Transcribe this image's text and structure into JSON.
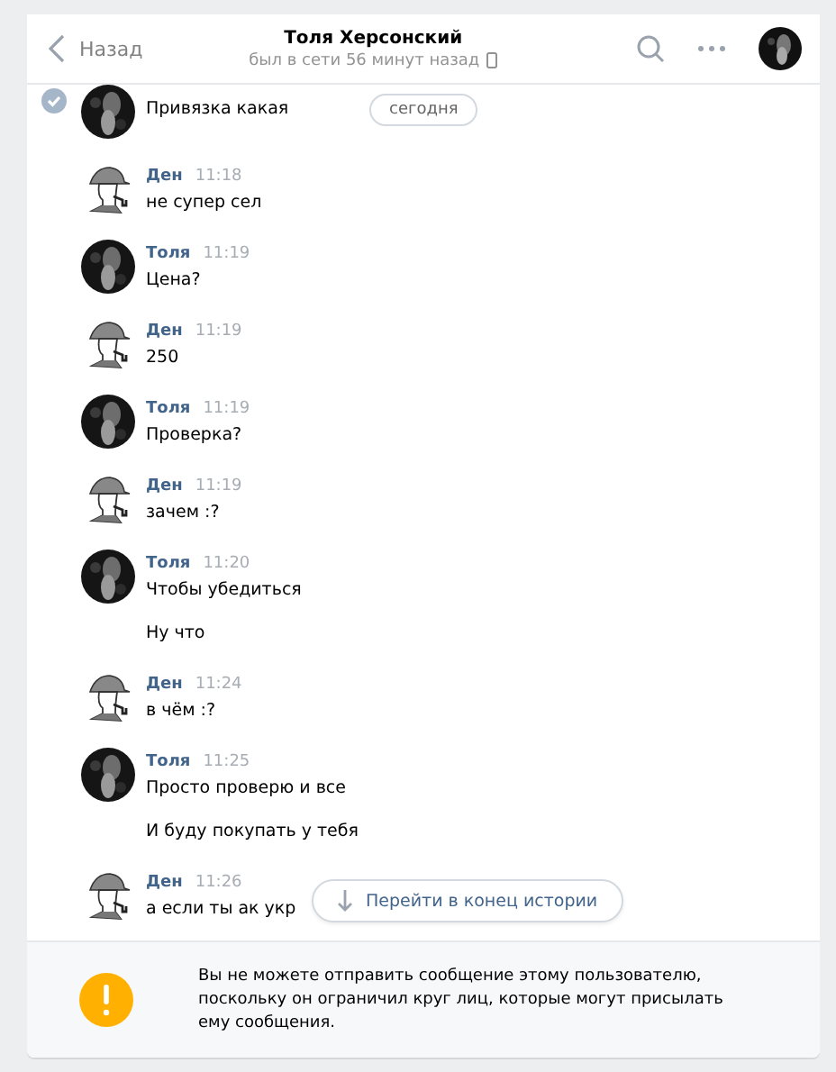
{
  "header": {
    "back": "Назад",
    "title": "Толя Херсонский",
    "status": "был в сети 56 минут назад"
  },
  "date_pill": "сегодня",
  "messages": [
    {
      "selected": true,
      "texts": [
        "Привязка какая"
      ]
    },
    {
      "kind": "detective",
      "selected": false,
      "author": "Ден",
      "time": "11:18",
      "texts": [
        "не супер сел"
      ]
    },
    {
      "selected": false,
      "author": "Толя",
      "time": "11:19",
      "texts": [
        "Цена?"
      ]
    },
    {
      "kind": "detective",
      "selected": false,
      "author": "Ден",
      "time": "11:19",
      "texts": [
        "250"
      ]
    },
    {
      "selected": false,
      "author": "Толя",
      "time": "11:19",
      "texts": [
        "Проверка?"
      ]
    },
    {
      "kind": "detective",
      "selected": false,
      "author": "Ден",
      "time": "11:19",
      "texts": [
        "зачем :?"
      ]
    },
    {
      "selected": false,
      "author": "Толя",
      "time": "11:20",
      "texts": [
        "Чтобы убедиться",
        "Ну что"
      ]
    },
    {
      "kind": "detective",
      "selected": false,
      "author": "Ден",
      "time": "11:24",
      "texts": [
        "в чём :?"
      ]
    },
    {
      "selected": false,
      "author": "Толя",
      "time": "11:25",
      "texts": [
        "Просто проверю и все",
        "И буду покупать у тебя"
      ]
    },
    {
      "kind": "detective",
      "selected": false,
      "author": "Ден",
      "time": "11:26",
      "texts": [
        "а если ты ак укр"
      ]
    }
  ],
  "jump_button": "Перейти в конец истории",
  "notice": "Вы не можете отправить сообщение этому пользователю, поскольку он ограничил круг лиц, которые могут присылать ему сообщения."
}
